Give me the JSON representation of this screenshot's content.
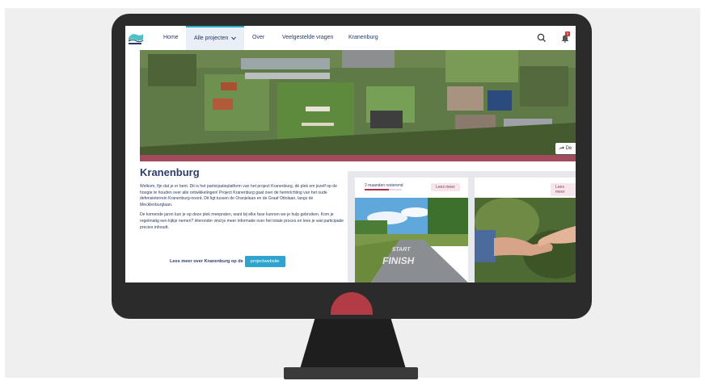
{
  "nav": {
    "items": [
      "Home",
      "Alle projecten",
      "Over",
      "Veelgestelde vragen",
      "Kranenburg"
    ],
    "notification_count": "3"
  },
  "hero": {
    "share_label": "De"
  },
  "intro": {
    "title": "Kranenburg",
    "paragraph1": "Welkom, fijn dat je er bent. Dit is het participatieplatform van het project Kranenburg, dé plek om jezelf op de hoogte te houden over alle ontwikkelingen! Project Kranenburg gaat over de herinrichting van het oude defensieterrein Kranenburg-noord. Dit ligt tussen de Oranjelaan en de Graaf Ottolaan, langs de Mecklenburglaan.",
    "paragraph2": "De komende jaren kun je op deze plek meepraten, want bij elke fase kunnen we je hulp gebruiken. Kom je regelmatig een kijkje nemen? Hieronder vind je meer informatie over het totale proces en lees je wat participatie precies inhoudt.",
    "cta_text": "Lees meer over Kranenburg op de",
    "cta_button": "projectwebsite"
  },
  "cards": [
    {
      "status": "2 maanden resterend",
      "more": "Lees meer",
      "progress": 0.65,
      "image": "start-finish-road"
    },
    {
      "status": "",
      "more": "Lees meer",
      "image": "handshake"
    }
  ],
  "colors": {
    "navy": "#263a66",
    "accent_blue": "#2ea4cf",
    "hero_strip": "#a44a5d",
    "power_led": "#b23c45"
  }
}
